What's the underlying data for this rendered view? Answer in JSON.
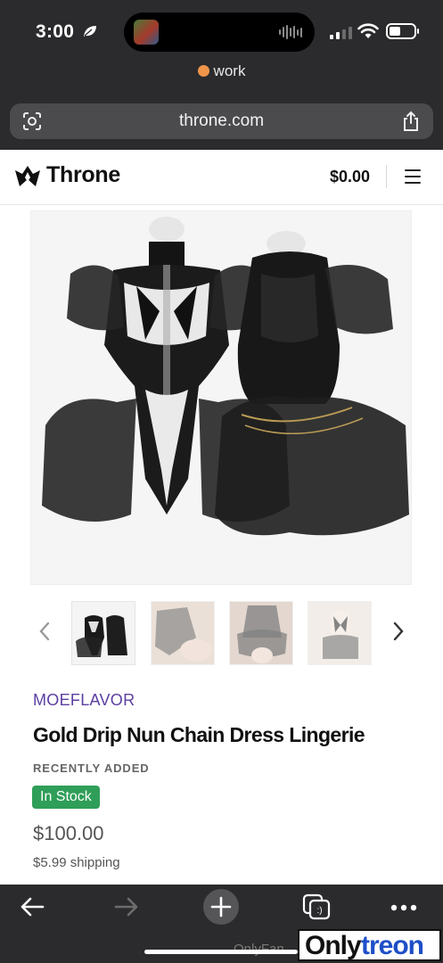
{
  "status_bar": {
    "time": "3:00",
    "battery_level": 0.45
  },
  "browser": {
    "profile_name": "work",
    "profile_color": "#f0954a",
    "url": "throne.com"
  },
  "site": {
    "brand": "Throne",
    "cart_total": "$0.00"
  },
  "product": {
    "vendor": "MOEFLAVOR",
    "name": "Gold Drip Nun Chain Dress Lingerie",
    "tag": "RECENTLY ADDED",
    "stock_status": "In Stock",
    "price": "$100.00",
    "shipping": "$5.99 shipping",
    "thumbnail_count": 4
  },
  "watermark": {
    "left_text": "OnlyFan",
    "brand_part1": "Only",
    "brand_part2": "treon"
  },
  "colors": {
    "vendor": "#5b3fa0",
    "stock_badge": "#2f9e58",
    "chrome": "#2b2b2d"
  },
  "icons": [
    "leaf-icon",
    "signal-icon",
    "wifi-icon",
    "battery-icon",
    "scan-icon",
    "share-icon",
    "crown-icon",
    "hamburger-icon",
    "chevron-left-icon",
    "chevron-right-icon",
    "back-arrow-icon",
    "forward-arrow-icon",
    "plus-icon",
    "tabs-icon",
    "more-icon"
  ]
}
